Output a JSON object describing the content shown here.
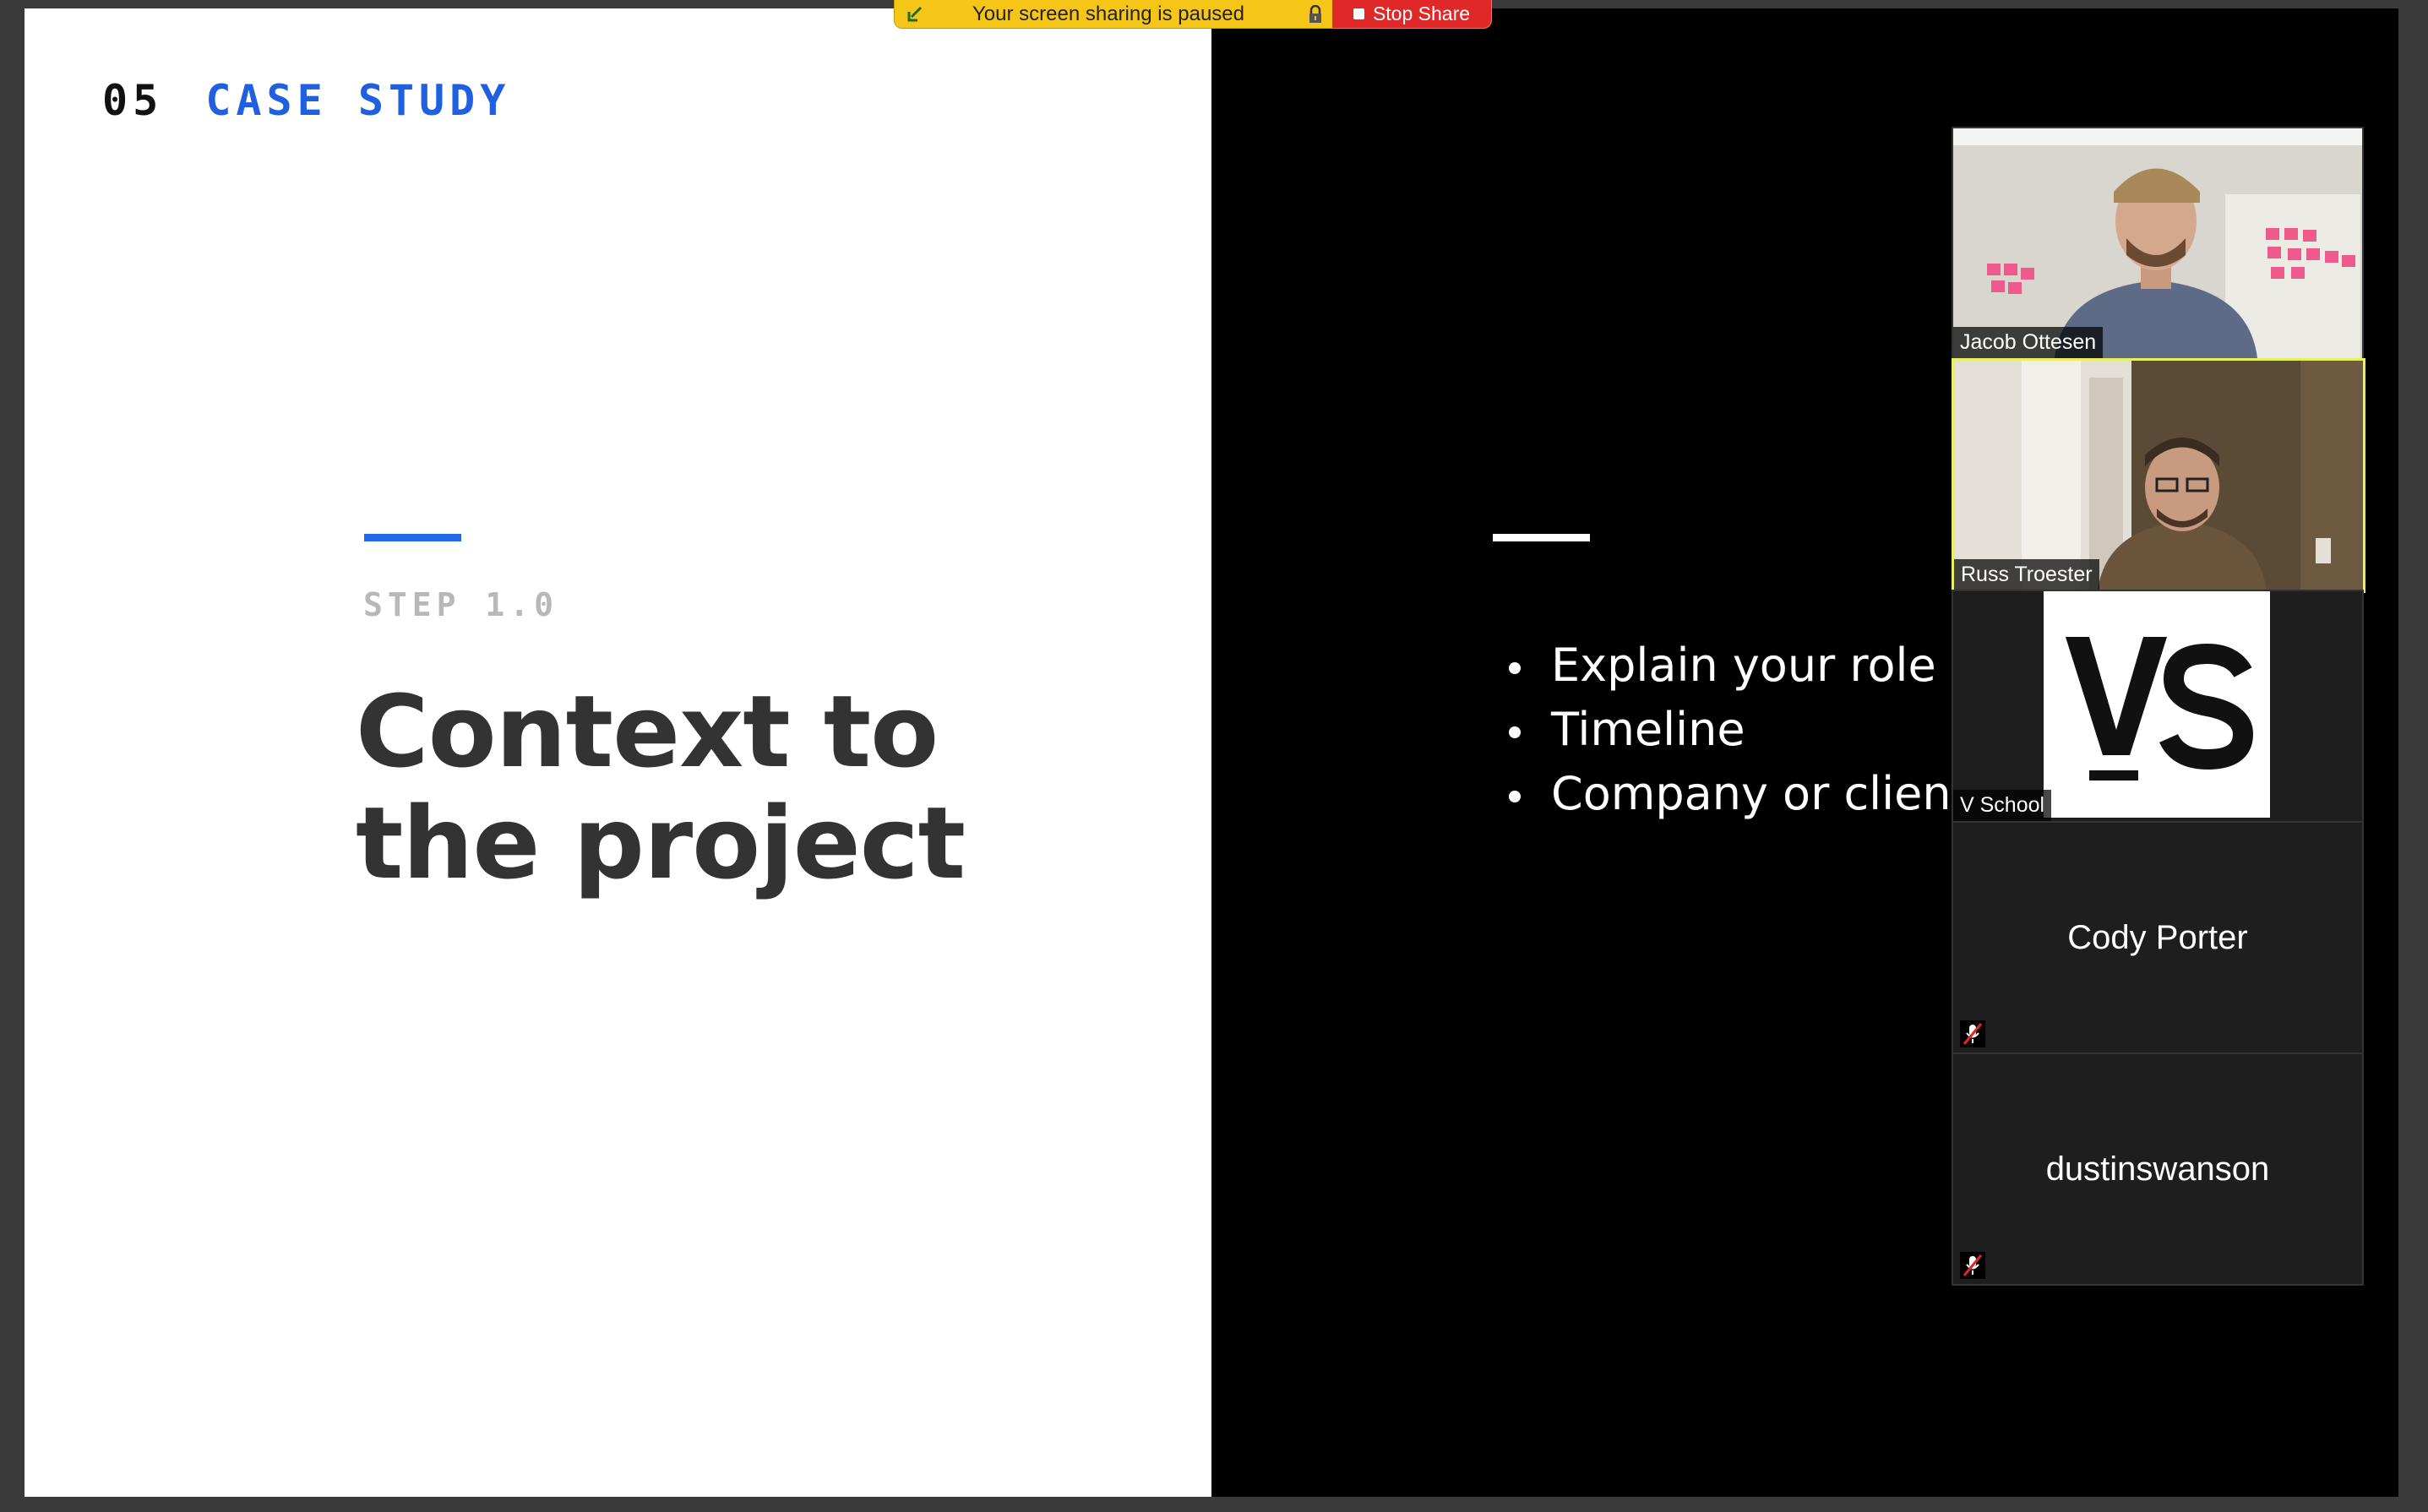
{
  "zoom_banner": {
    "paused_text": "Your screen sharing is paused",
    "stop_share_label": "Stop Share",
    "color": "#f5c518",
    "stop_color": "#e02828"
  },
  "slide_left": {
    "section_number": "05",
    "section_name": "CASE STUDY",
    "step_label": "STEP 1.0",
    "title_line1": "Context to",
    "title_line2": "the project",
    "accent_color": "#1f6ae8"
  },
  "slide_right": {
    "bullets": [
      "Explain your role",
      "Timeline",
      "Company or client"
    ]
  },
  "participants": [
    {
      "name": "Jacob Ottesen",
      "type": "video"
    },
    {
      "name": "Russ Troester",
      "type": "video",
      "active_speaker": true
    },
    {
      "name": "V School",
      "type": "logo",
      "logo_text": "VS"
    },
    {
      "name": "Cody Porter",
      "type": "name-only",
      "muted": true
    },
    {
      "name": "dustinswanson",
      "type": "name-only",
      "muted": true
    }
  ]
}
